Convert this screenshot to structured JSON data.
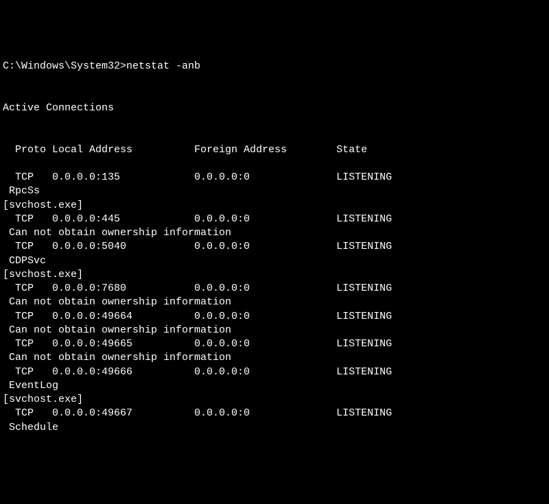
{
  "prompt": {
    "path": "C:\\Windows\\System32>",
    "command": "netstat -anb"
  },
  "section_title": "Active Connections",
  "headers": {
    "proto": "Proto",
    "local": "Local Address",
    "foreign": "Foreign Address",
    "state": "State"
  },
  "entries": [
    {
      "proto": "TCP",
      "local": "0.0.0.0:135",
      "foreign": "0.0.0.0:0",
      "state": "LISTENING",
      "owner": "RpcSs",
      "exe": "[svchost.exe]"
    },
    {
      "proto": "TCP",
      "local": "0.0.0.0:445",
      "foreign": "0.0.0.0:0",
      "state": "LISTENING",
      "error": "Can not obtain ownership information"
    },
    {
      "proto": "TCP",
      "local": "0.0.0.0:5040",
      "foreign": "0.0.0.0:0",
      "state": "LISTENING",
      "owner": "CDPSvc",
      "exe": "[svchost.exe]"
    },
    {
      "proto": "TCP",
      "local": "0.0.0.0:7680",
      "foreign": "0.0.0.0:0",
      "state": "LISTENING",
      "error": "Can not obtain ownership information"
    },
    {
      "proto": "TCP",
      "local": "0.0.0.0:49664",
      "foreign": "0.0.0.0:0",
      "state": "LISTENING",
      "error": "Can not obtain ownership information"
    },
    {
      "proto": "TCP",
      "local": "0.0.0.0:49665",
      "foreign": "0.0.0.0:0",
      "state": "LISTENING",
      "error": "Can not obtain ownership information"
    },
    {
      "proto": "TCP",
      "local": "0.0.0.0:49666",
      "foreign": "0.0.0.0:0",
      "state": "LISTENING",
      "owner": "EventLog",
      "exe": "[svchost.exe]"
    },
    {
      "proto": "TCP",
      "local": "0.0.0.0:49667",
      "foreign": "0.0.0.0:0",
      "state": "LISTENING",
      "owner": "Schedule"
    }
  ]
}
